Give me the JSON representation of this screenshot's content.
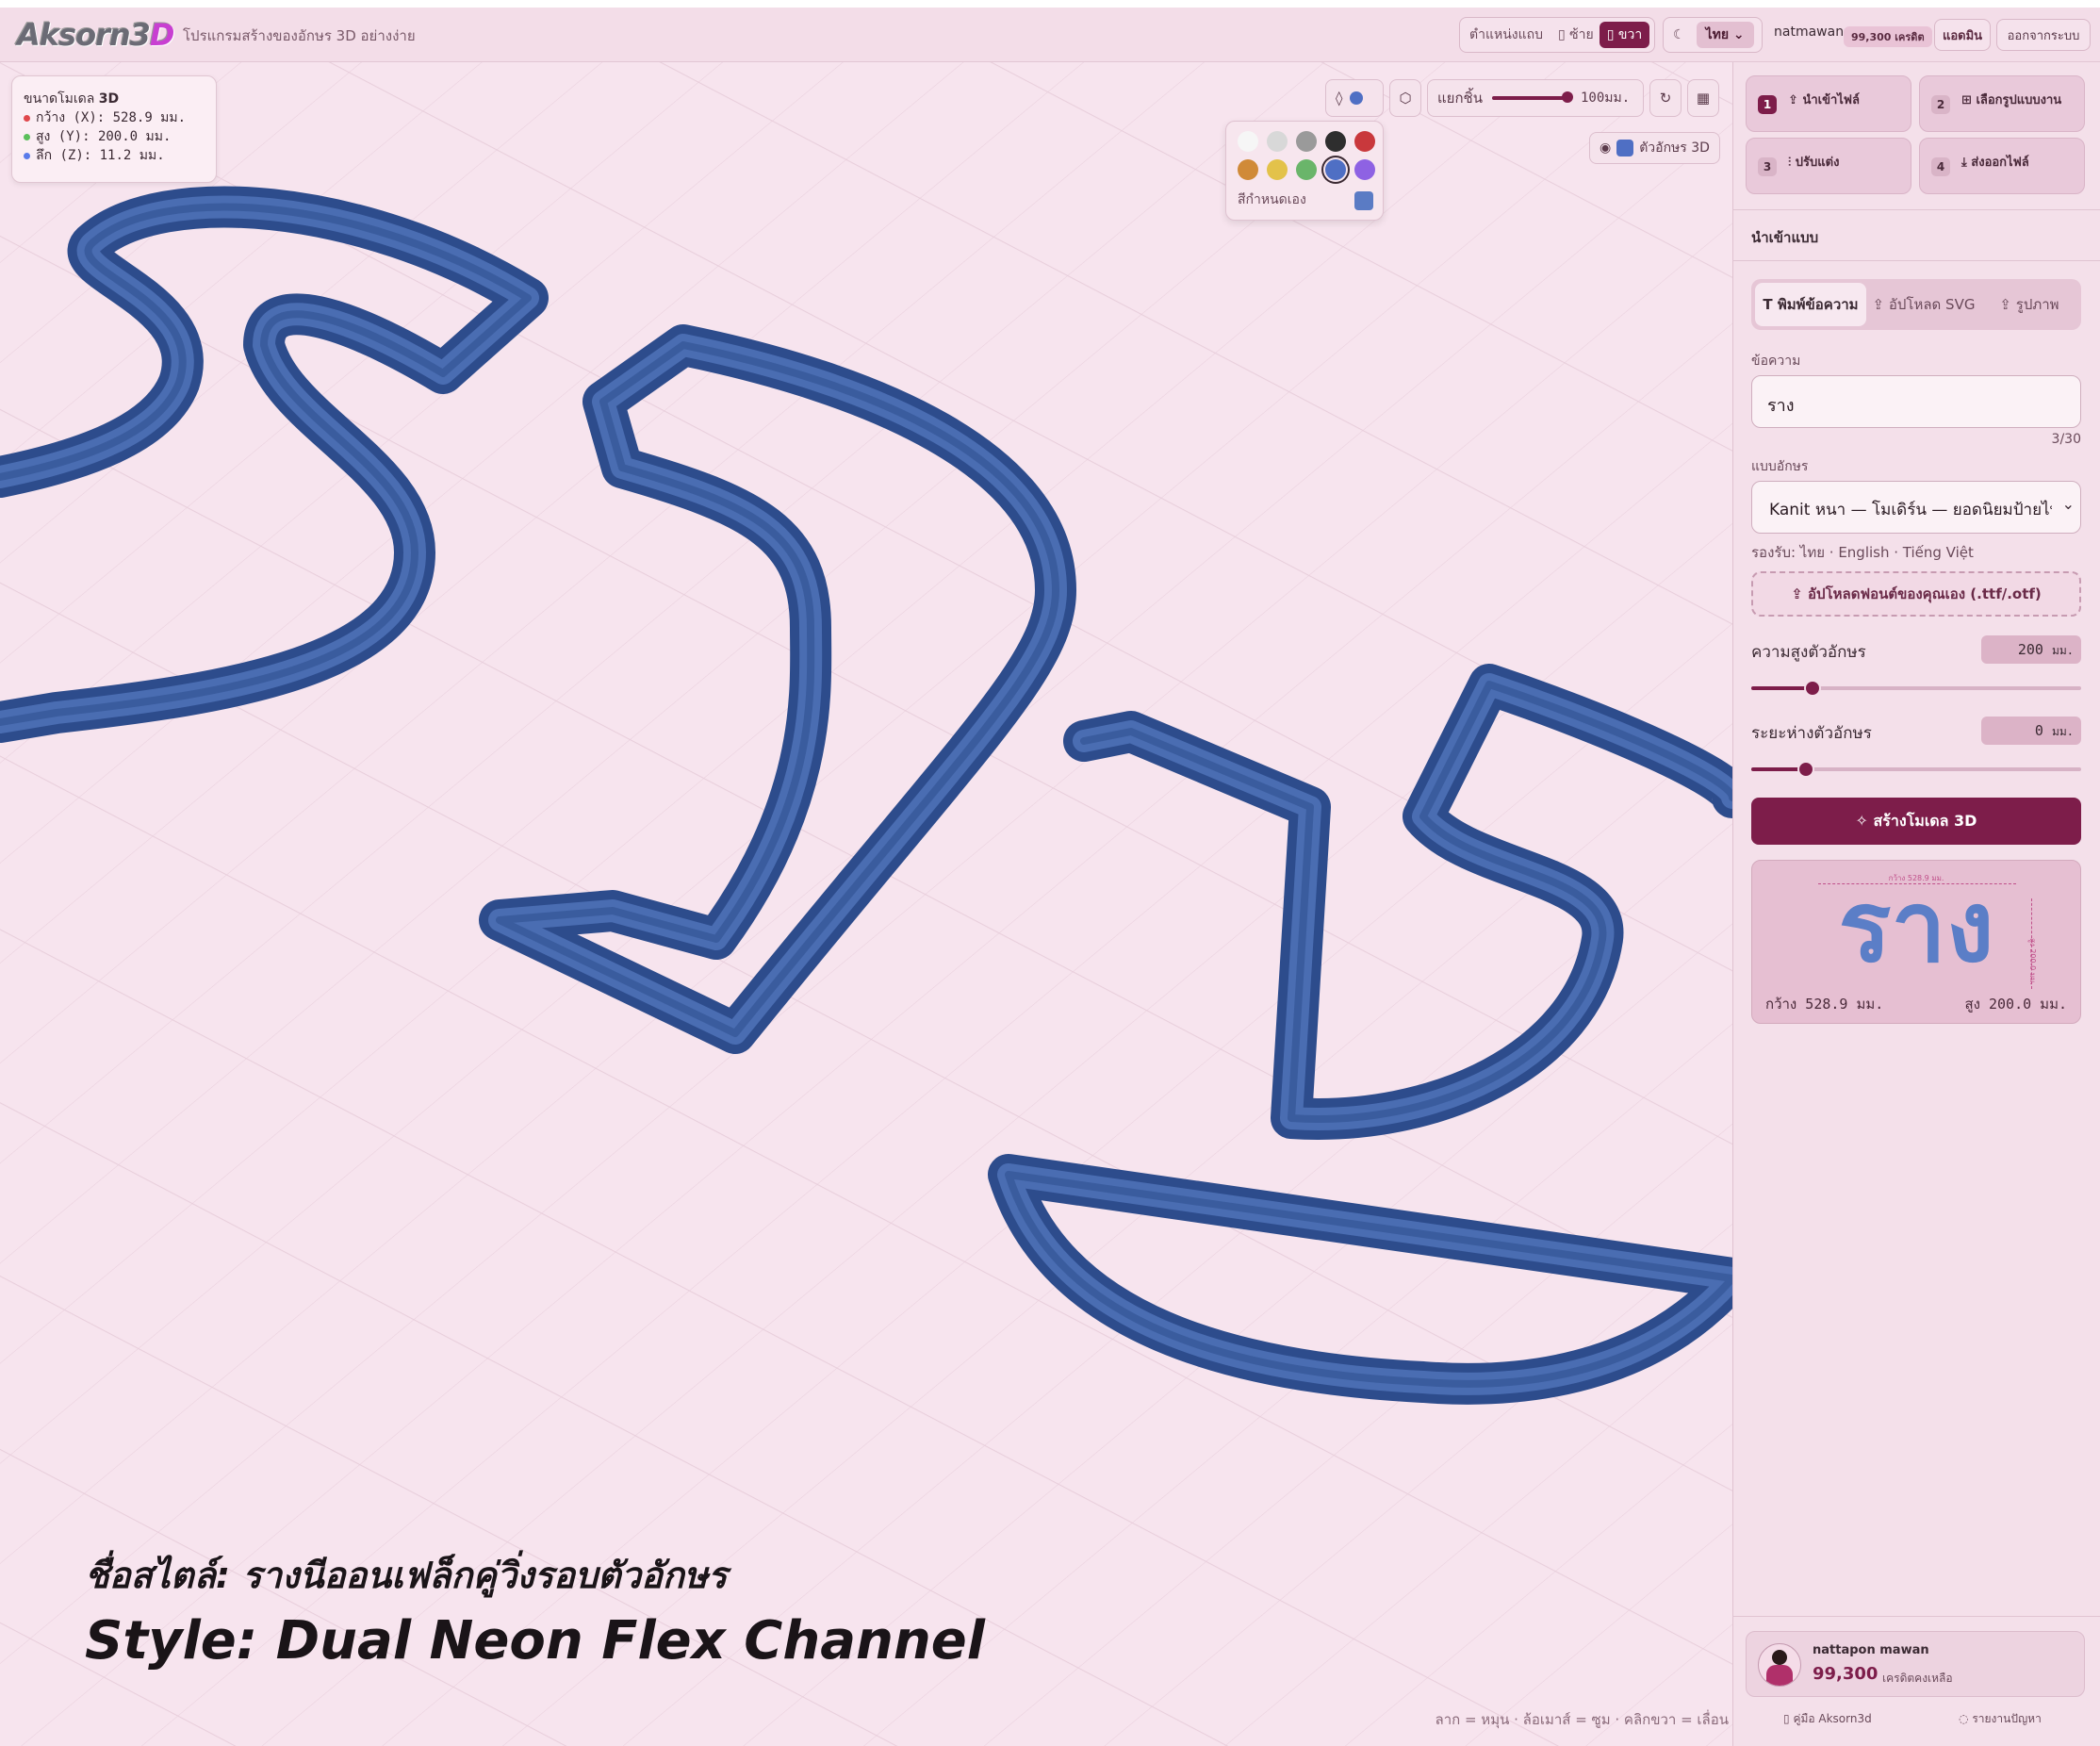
{
  "header": {
    "logo_main": "Aksorn3",
    "logo_accent": "D",
    "tagline": "โปรแกรมสร้างของอักษร 3D อย่างง่าย",
    "position_label": "ตำแหน่งแถบ",
    "left_label": "ซ้าย",
    "right_label": "ขวา",
    "language": "ไทย",
    "username": "natmawan",
    "credits_chip": "99,300 เครดิต",
    "admin_label": "แอดมิน",
    "logout_label": "ออกจากระบบ"
  },
  "dimensions": {
    "title": "ขนาดโมเดล",
    "title_suffix": "3D",
    "width": "กว้าง (X): 528.9 มม.",
    "height": "สูง (Y): 200.0 มม.",
    "depth": "ลึก (Z): 11.2 มม.",
    "colors": [
      "#e0474c",
      "#5bbf5b",
      "#5a7bea"
    ]
  },
  "viewer": {
    "explode_label": "แยกชิ้น",
    "explode_value": "100มม.",
    "explode_fraction": 0.96,
    "text3d_label": "ตัวอักษร 3D",
    "custom_color_label": "สีกำหนดเอง",
    "swatches": [
      "#f6f6f6",
      "#d8d8d8",
      "#9a9a9a",
      "#2e2e2e",
      "#c9383c",
      "#d08a38",
      "#e3c24a",
      "#6ab56a",
      "#4f6fc4",
      "#8e62e3"
    ],
    "selected_color": "#4f6fc4",
    "model_text": "ราง",
    "model_color": "#3c5fa0",
    "caption_th": "ชื่อสไตล์: รางนีออนเฟล็กคู่วิ่งรอบตัวอักษร",
    "caption_en": "Style: Dual Neon Flex Channel",
    "hint": "ลาก = หมุน · ล้อเมาส์ = ซูม · คลิกขวา = เลื่อน"
  },
  "sidebar": {
    "steps": [
      {
        "num": "1",
        "label": "นำเข้าไฟล์"
      },
      {
        "num": "2",
        "label": "เลือกรูปแบบงาน"
      },
      {
        "num": "3",
        "label": "ปรับแต่ง"
      },
      {
        "num": "4",
        "label": "ส่งออกไฟล์"
      }
    ],
    "section_title": "นำเข้าแบบ",
    "tabs": [
      "พิมพ์ข้อความ",
      "อัปโหลด SVG",
      "รูปภาพ"
    ],
    "text_label": "ข้อความ",
    "text_value": "ราง",
    "char_count": "3/30",
    "font_label": "แบบอักษร",
    "font_value": "Kanit หนา — โมเดิร์น — ยอดนิยมป้ายไทย",
    "supports": "รองรับ: ไทย · English · Tiếng Việt",
    "upload_font": "อัปโหลดฟอนต์ของคุณเอง (.ttf/.otf)",
    "height_label": "ความสูงตัวอักษร",
    "height_value": "200",
    "height_unit": "มม.",
    "height_fraction": 0.18,
    "spacing_label": "ระยะห่างตัวอักษร",
    "spacing_value": "0",
    "spacing_unit": "มม.",
    "spacing_fraction": 0.16,
    "generate_label": "สร้างโมเดล 3D",
    "preview_text": "ราง",
    "preview_small_top": "กว้าง 528.9 มม.",
    "preview_small_side": "สูง 200.0 มม.",
    "preview_width": "กว้าง 528.9 มม.",
    "preview_height": "สูง 200.0 มม.",
    "user_name": "nattapon mawan",
    "user_credits": "99,300",
    "user_credits_label": "เครดิตคงเหลือ",
    "manual_link": "คู่มือ Aksorn3d",
    "report_link": "รายงานปัญหา"
  }
}
